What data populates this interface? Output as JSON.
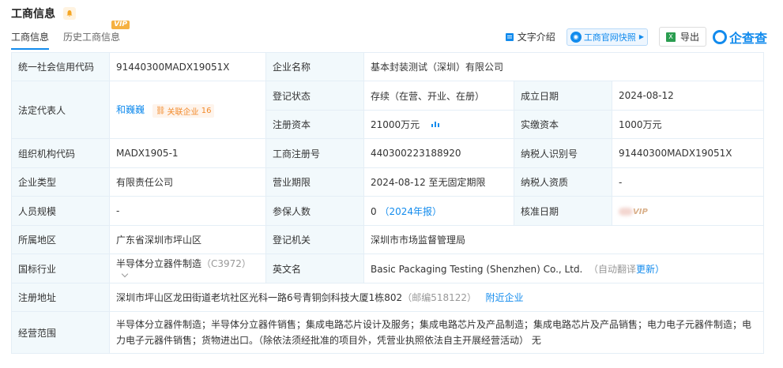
{
  "header": {
    "title": "工商信息",
    "tabs": [
      {
        "label": "工商信息",
        "active": true
      },
      {
        "label": "历史工商信息",
        "badge": "VIP"
      }
    ],
    "actions": {
      "text_intro": "文字介绍",
      "snapshot": "工商官网快照",
      "export": "导出",
      "brand": "企查查"
    }
  },
  "rows": {
    "credit_code_label": "统一社会信用代码",
    "credit_code": "91440300MADX19051X",
    "company_name_label": "企业名称",
    "company_name": "基本封装测试（深圳）有限公司",
    "legal_rep_label": "法定代表人",
    "legal_rep": "和巍巍",
    "related_label": "关联企业",
    "related_count": "16",
    "status_label": "登记状态",
    "status": "存续（在营、开业、在册）",
    "est_date_label": "成立日期",
    "est_date": "2024-08-12",
    "reg_capital_label": "注册资本",
    "reg_capital": "21000万元",
    "paid_capital_label": "实缴资本",
    "paid_capital": "1000万元",
    "org_code_label": "组织机构代码",
    "org_code": "MADX1905-1",
    "reg_no_label": "工商注册号",
    "reg_no": "440300223188920",
    "taxpayer_id_label": "纳税人识别号",
    "taxpayer_id": "91440300MADX19051X",
    "type_label": "企业类型",
    "type": "有限责任公司",
    "term_label": "营业期限",
    "term": "2024-08-12 至无固定期限",
    "taxpayer_qual_label": "纳税人资质",
    "taxpayer_qual": "-",
    "staff_label": "人员规模",
    "staff": "-",
    "insured_label": "参保人数",
    "insured": "0",
    "insured_year": "（2024年报）",
    "approval_label": "核准日期",
    "approval_vip": "VIP",
    "region_label": "所属地区",
    "region": "广东省深圳市坪山区",
    "authority_label": "登记机关",
    "authority": "深圳市市场监督管理局",
    "industry_label": "国标行业",
    "industry": "半导体分立器件制造",
    "industry_code": "（C3972）",
    "english_label": "英文名",
    "english": "Basic Packaging Testing (Shenzhen) Co., Ltd.",
    "auto_translate": "（自动翻译",
    "update": "更新）",
    "address_label": "注册地址",
    "address": "深圳市坪山区龙田街道老坑社区光科一路6号青铜剑科技大厦1栋802",
    "postcode": "（邮编518122）",
    "nearby": "附近企业",
    "scope_label": "经营范围",
    "scope": "半导体分立器件制造；半导体分立器件销售；集成电路芯片设计及服务；集成电路芯片及产品制造；集成电路芯片及产品销售；电力电子元器件制造；电力电子元器件销售；货物进出口。（除依法须经批准的项目外，凭营业执照依法自主开展经营活动） 无"
  },
  "colors": {
    "accent": "#128bed",
    "label_bg": "#f2f9fc",
    "orange": "#f28a2a"
  }
}
